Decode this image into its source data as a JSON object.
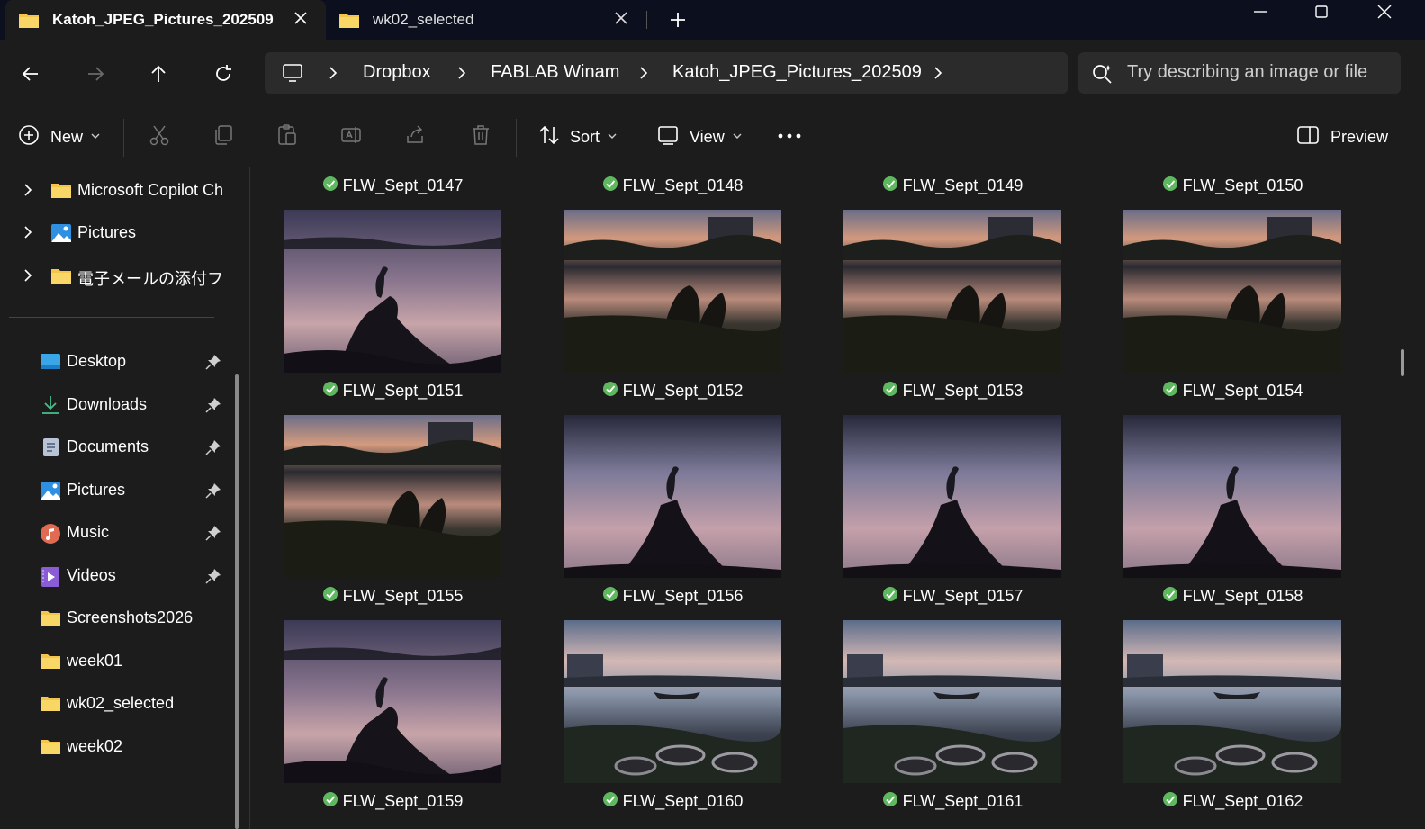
{
  "tabs": [
    {
      "label": "Katoh_JPEG_Pictures_202509",
      "active": true
    },
    {
      "label": "wk02_selected",
      "active": false
    }
  ],
  "window_controls": [
    "minimize-icon",
    "maximize-icon",
    "close-icon"
  ],
  "breadcrumb": [
    "Dropbox",
    "FABLAB Winam",
    "Katoh_JPEG_Pictures_202509"
  ],
  "search": {
    "placeholder": "Try describing an image or file"
  },
  "toolbar": {
    "new_label": "New",
    "sort_label": "Sort",
    "view_label": "View",
    "preview_label": "Preview",
    "icons": [
      "cut-icon",
      "copy-icon",
      "paste-icon",
      "rename-icon",
      "share-icon",
      "delete-icon"
    ]
  },
  "sidebar": {
    "tree": [
      {
        "label": "Microsoft Copilot Ch",
        "icon": "folder-icon"
      },
      {
        "label": "Pictures",
        "icon": "pictures-icon"
      },
      {
        "label": "電子メールの添付ファ",
        "icon": "folder-icon"
      }
    ],
    "quick": [
      {
        "label": "Desktop",
        "icon": "desktop-icon",
        "pinned": true
      },
      {
        "label": "Downloads",
        "icon": "download-icon",
        "pinned": true
      },
      {
        "label": "Documents",
        "icon": "documents-icon",
        "pinned": true
      },
      {
        "label": "Pictures",
        "icon": "pictures-icon",
        "pinned": true
      },
      {
        "label": "Music",
        "icon": "music-icon",
        "pinned": true
      },
      {
        "label": "Videos",
        "icon": "videos-icon",
        "pinned": true
      },
      {
        "label": "Screenshots2026",
        "icon": "folder-icon",
        "pinned": false
      },
      {
        "label": "week01",
        "icon": "folder-icon",
        "pinned": false
      },
      {
        "label": "wk02_selected",
        "icon": "folder-icon",
        "pinned": false
      },
      {
        "label": "week02",
        "icon": "folder-icon",
        "pinned": false
      }
    ]
  },
  "files": {
    "top_captions": [
      "FLW_Sept_0147",
      "FLW_Sept_0148",
      "FLW_Sept_0149",
      "FLW_Sept_0150"
    ],
    "rows": [
      [
        {
          "name": "FLW_Sept_0151",
          "scene": "heron-closeup"
        },
        {
          "name": "FLW_Sept_0152",
          "scene": "lake-stump-wide"
        },
        {
          "name": "FLW_Sept_0153",
          "scene": "lake-stump-wide"
        },
        {
          "name": "FLW_Sept_0154",
          "scene": "lake-stump-wide"
        }
      ],
      [
        {
          "name": "FLW_Sept_0155",
          "scene": "lake-stump-wide"
        },
        {
          "name": "FLW_Sept_0156",
          "scene": "heron-stump"
        },
        {
          "name": "FLW_Sept_0157",
          "scene": "heron-stump"
        },
        {
          "name": "FLW_Sept_0158",
          "scene": "heron-stump"
        }
      ],
      [
        {
          "name": "FLW_Sept_0159",
          "scene": "heron-closeup"
        },
        {
          "name": "FLW_Sept_0160",
          "scene": "boats-tires"
        },
        {
          "name": "FLW_Sept_0161",
          "scene": "boats-tires"
        },
        {
          "name": "FLW_Sept_0162",
          "scene": "boats-tires"
        }
      ]
    ],
    "sync_status_icon": "synced-check-icon",
    "sync_color": "#5fb85f"
  },
  "colors": {
    "titlebar": "#0b0f1e",
    "background": "#1c1c1c",
    "folder": "#f3c54a"
  }
}
